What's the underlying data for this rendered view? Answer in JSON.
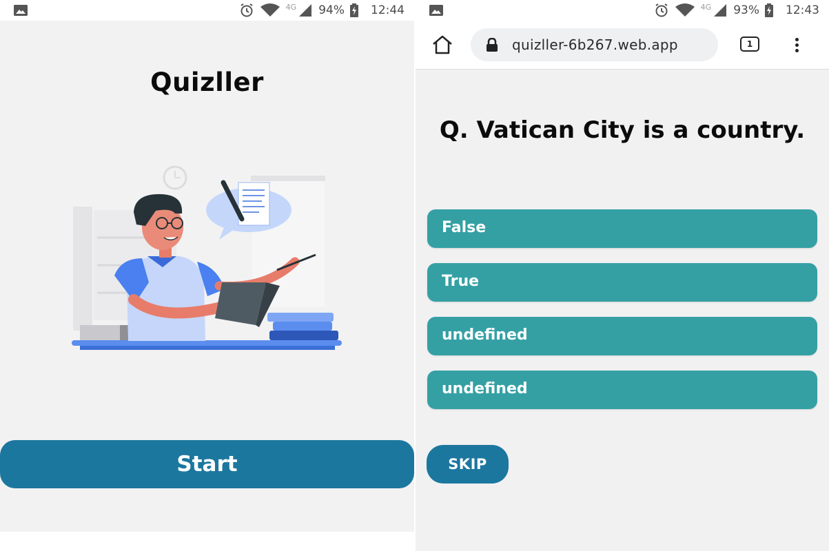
{
  "left_screen": {
    "status_bar": {
      "battery": "94%",
      "time": "12:44",
      "network": "4G",
      "icons": [
        "gallery-icon",
        "alarm-icon",
        "wifi-icon",
        "cell-signal-icon",
        "battery-charging-icon"
      ]
    },
    "app_title": "Quizller",
    "illustration": "teacher-with-book-illustration",
    "start_label": "Start"
  },
  "right_screen": {
    "status_bar": {
      "battery": "93%",
      "time": "12:43",
      "network": "4G",
      "icons": [
        "gallery-icon",
        "alarm-icon",
        "wifi-icon",
        "cell-signal-icon",
        "battery-charging-icon"
      ]
    },
    "browser": {
      "url": "quizller-6b267.web.app",
      "tab_count": "1",
      "icons": [
        "home-icon",
        "lock-icon",
        "tabs-icon",
        "more-vert-icon"
      ]
    },
    "question": "Q. Vatican City is a country.",
    "options": [
      "False",
      "True",
      "undefined",
      "undefined"
    ],
    "skip_label": "SKIP"
  },
  "colors": {
    "primary_button": "#1c779f",
    "option_button": "#34a0a4",
    "background": "#f2f2f3"
  }
}
